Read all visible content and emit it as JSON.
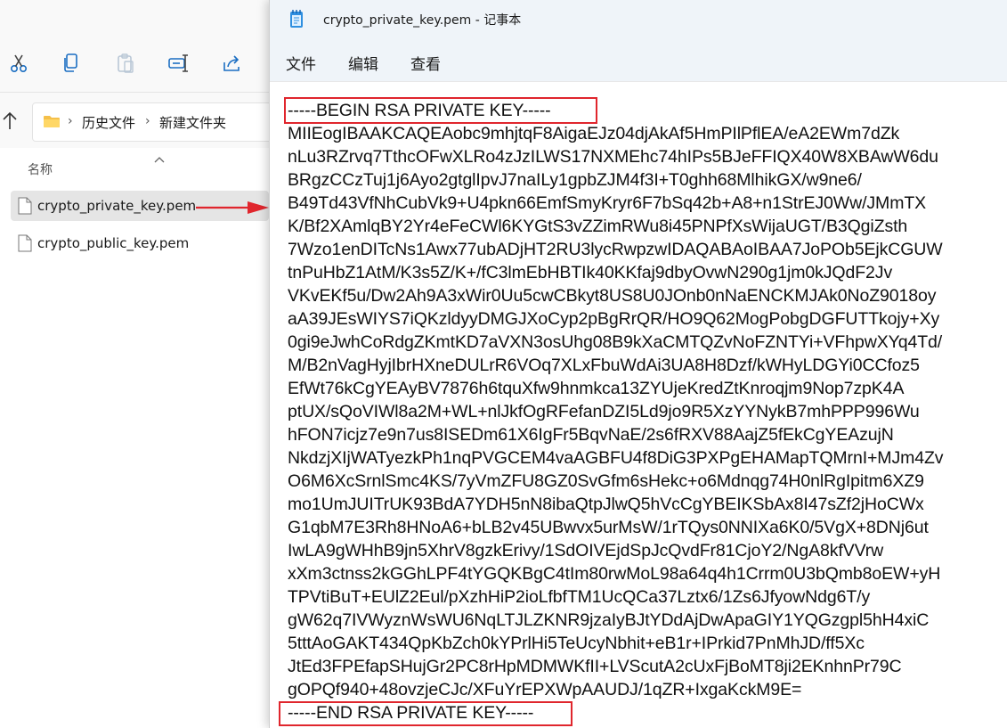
{
  "explorer": {
    "toolbar": {
      "cut_icon": "scissors-icon",
      "copy_icon": "copy-icon",
      "paste_icon": "paste-icon",
      "rename_icon": "rename-icon",
      "share_icon": "share-icon"
    },
    "breadcrumb": [
      "历史文件",
      "新建文件夹"
    ],
    "column_header": "名称",
    "files": [
      {
        "name": "crypto_private_key.pem",
        "selected": true
      },
      {
        "name": "crypto_public_key.pem",
        "selected": false
      }
    ],
    "annotation_color": "#e0262d"
  },
  "notepad": {
    "title": "crypto_private_key.pem - 记事本",
    "menu": [
      "文件",
      "编辑",
      "查看"
    ],
    "lines": [
      "-----BEGIN RSA PRIVATE KEY-----",
      "MIIEogIBAAKCAQEAobc9mhjtqF8AigaEJz04djAkAf5HmPIlPflEA/eA2EWm7dZk",
      "nLu3RZrvq7TthcOFwXLRo4zJzILWS17NXMEhc74hIPs5BJeFFIQX40W8XBAwW6du",
      "BRgzCCzTuj1j6Ayo2gtglIpvJ7naILy1gpbZJM4f3I+T0ghh68MlhikGX/w9ne6/",
      "B49Td43VfNhCubVk9+U4pkn66EmfSmyKryr6F7bSq42b+A8+n1StrEJ0Ww/JMmTX",
      "K/Bf2XAmlqBY2Yr4eFeCWl6KYGtS3vZZimRWu8i45PNPfXsWijaUGT/B3QgiZsth",
      "7Wzo1enDITcNs1Awx77ubADjHT2RU3lycRwpzwIDAQABAoIBAA7JoPOb5EjkCGUW",
      "tnPuHbZ1AtM/K3s5Z/K+/fC3lmEbHBTIk40KKfaj9dbyOvwN290g1jm0kJQdF2Jv",
      "VKvEKf5u/Dw2Ah9A3xWir0Uu5cwCBkyt8US8U0JOnb0nNaENCKMJAk0NoZ9018oy",
      "aA39JEsWIYS7iQKzldyyDMGJXoCyp2pBgRrQR/HO9Q62MogPobgDGFUTTkojy+Xy",
      "0gi9eJwhCoRdgZKmtKD7aVXN3osUhg08B9kXaCMTQZvNoFZNTYi+VFhpwXYq4Td/",
      "M/B2nVagHyjIbrHXneDULrR6VOq7XLxFbuWdAi3UA8H8Dzf/kWHyLDGYi0CCfoz5",
      "EfWt76kCgYEAyBV7876h6tquXfw9hnmkca13ZYUjeKredZtKnroqjm9Nop7zpK4A",
      "ptUX/sQoVIWl8a2M+WL+nlJkfOgRFefanDZI5Ld9jo9R5XzYYNykB7mhPPP996Wu",
      "hFON7icjz7e9n7us8ISEDm61X6IgFr5BqvNaE/2s6fRXV88AajZ5fEkCgYEAzujN",
      "NkdzjXIjWATyezkPh1nqPVGCEM4vaAGBFU4f8DiG3PXPgEHAMapTQMrnI+MJm4Zv",
      "O6M6XcSrnlSmc4KS/7yVmZFU8GZ0SvGfm6sHekc+o6Mdnqg74H0nlRgIpitm6XZ9",
      "mo1UmJUITrUK93BdA7YDH5nN8ibaQtpJlwQ5hVcCgYBEIKSbAx8I47sZf2jHoCWx",
      "G1qbM7E3Rh8HNoA6+bLB2v45UBwvx5urMsW/1rTQys0NNIXa6K0/5VgX+8DNj6ut",
      "IwLA9gWHhB9jn5XhrV8gzkErivy/1SdOIVEjdSpJcQvdFr81CjoY2/NgA8kfVVrw",
      "xXm3ctnss2kGGhLPF4tYGQKBgC4tIm80rwMoL98a64q4h1Crrm0U3bQmb8oEW+yH",
      "TPVtiBuT+EUlZ2Eul/pXzhHiP2ioLfbfTM1UcQCa37Lztx6/1Zs6JfyowNdg6T/y",
      "gW62q7IVWyznWsWU6NqLTJLZKNR9jzaIyBJtYDdAjDwApaGIY1YQGzgpl5hH4xiC",
      "5tttAoGAKT434QpKbZch0kYPrlHi5TeUcyNbhit+eB1r+IPrkid7PnMhJD/ff5Xc",
      "JtEd3FPEfapSHujGr2PC8rHpMDMWKfII+LVScutA2cUxFjBoMT8ji2EKnhnPr79C",
      "gOPQf940+48ovzjeCJc/XFuYrEPXWpAAUDJ/1qZR+IxgaKckM9E=",
      "-----END RSA PRIVATE KEY-----"
    ]
  }
}
